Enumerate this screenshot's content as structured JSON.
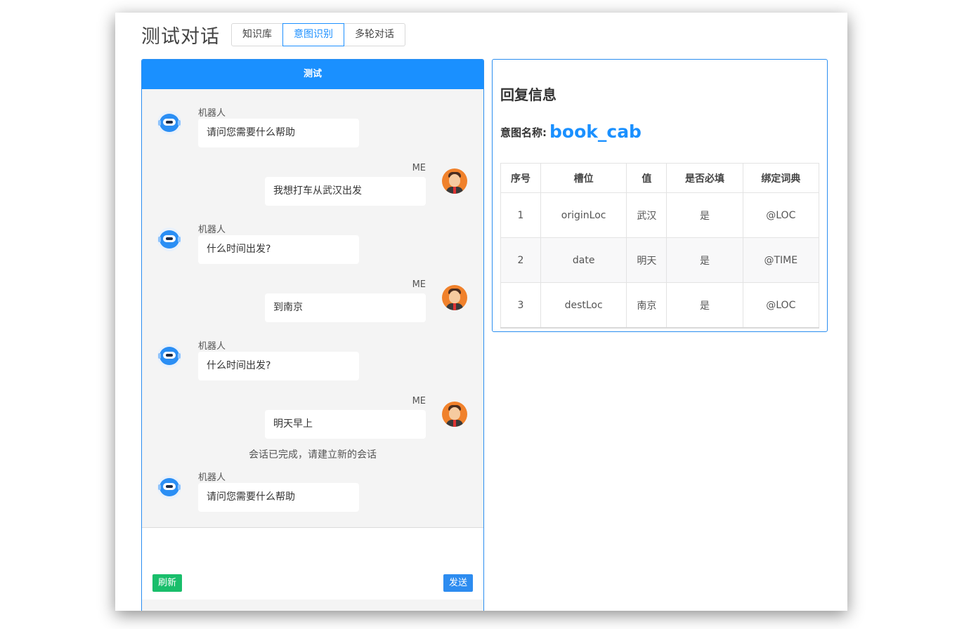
{
  "page": {
    "title": "测试对话"
  },
  "tabs": [
    {
      "label": "知识库",
      "active": false
    },
    {
      "label": "意图识别",
      "active": true
    },
    {
      "label": "多轮对话",
      "active": false
    }
  ],
  "chat": {
    "header": "测试",
    "bot_name": "机器人",
    "user_name": "ME",
    "messages": [
      {
        "from": "bot",
        "text": "请问您需要什么帮助"
      },
      {
        "from": "user",
        "text": "我想打车从武汉出发"
      },
      {
        "from": "bot",
        "text": "什么时间出发?"
      },
      {
        "from": "user",
        "text": "到南京"
      },
      {
        "from": "bot",
        "text": "什么时间出发?"
      },
      {
        "from": "user",
        "text": "明天早上"
      },
      {
        "from": "system",
        "text": "会话已完成，请建立新的会话"
      },
      {
        "from": "bot",
        "text": "请问您需要什么帮助"
      }
    ],
    "input_value": "",
    "refresh_label": "刷新",
    "send_label": "发送"
  },
  "reply": {
    "title": "回复信息",
    "intent_label": "意图名称:",
    "intent_value": "book_cab",
    "columns": [
      "序号",
      "槽位",
      "值",
      "是否必填",
      "绑定词典"
    ],
    "rows": [
      [
        "1",
        "originLoc",
        "武汉",
        "是",
        "@LOC"
      ],
      [
        "2",
        "date",
        "明天",
        "是",
        "@TIME"
      ],
      [
        "3",
        "destLoc",
        "南京",
        "是",
        "@LOC"
      ]
    ]
  },
  "colors": {
    "accent": "#1a90ff",
    "success": "#19be6b",
    "chat_bg": "#f4f4f4"
  },
  "icons": {
    "bot": "robot-avatar-icon",
    "user": "user-avatar-icon"
  }
}
